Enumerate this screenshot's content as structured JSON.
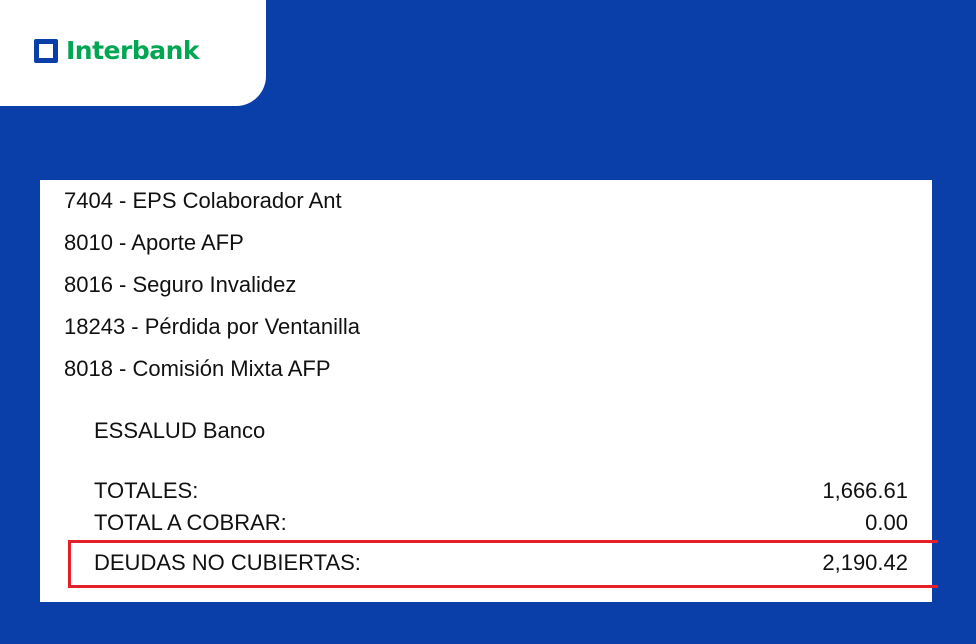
{
  "brand": {
    "name": "Interbank",
    "colors": {
      "primary": "#0a3ea8",
      "logo_text": "#00a652",
      "highlight": "#e3202a"
    }
  },
  "document": {
    "items": [
      "7404 - EPS Colaborador Ant",
      "8010 - Aporte AFP",
      "8016 - Seguro Invalidez",
      "18243 - Pérdida por Ventanilla",
      "8018 - Comisión Mixta AFP"
    ],
    "essalud_label": "ESSALUD Banco",
    "totals": [
      {
        "label": "TOTALES:",
        "value": "1,666.61"
      },
      {
        "label": "TOTAL A COBRAR:",
        "value": "0.00"
      },
      {
        "label": "DEUDAS NO CUBIERTAS:",
        "value": "2,190.42"
      }
    ]
  }
}
